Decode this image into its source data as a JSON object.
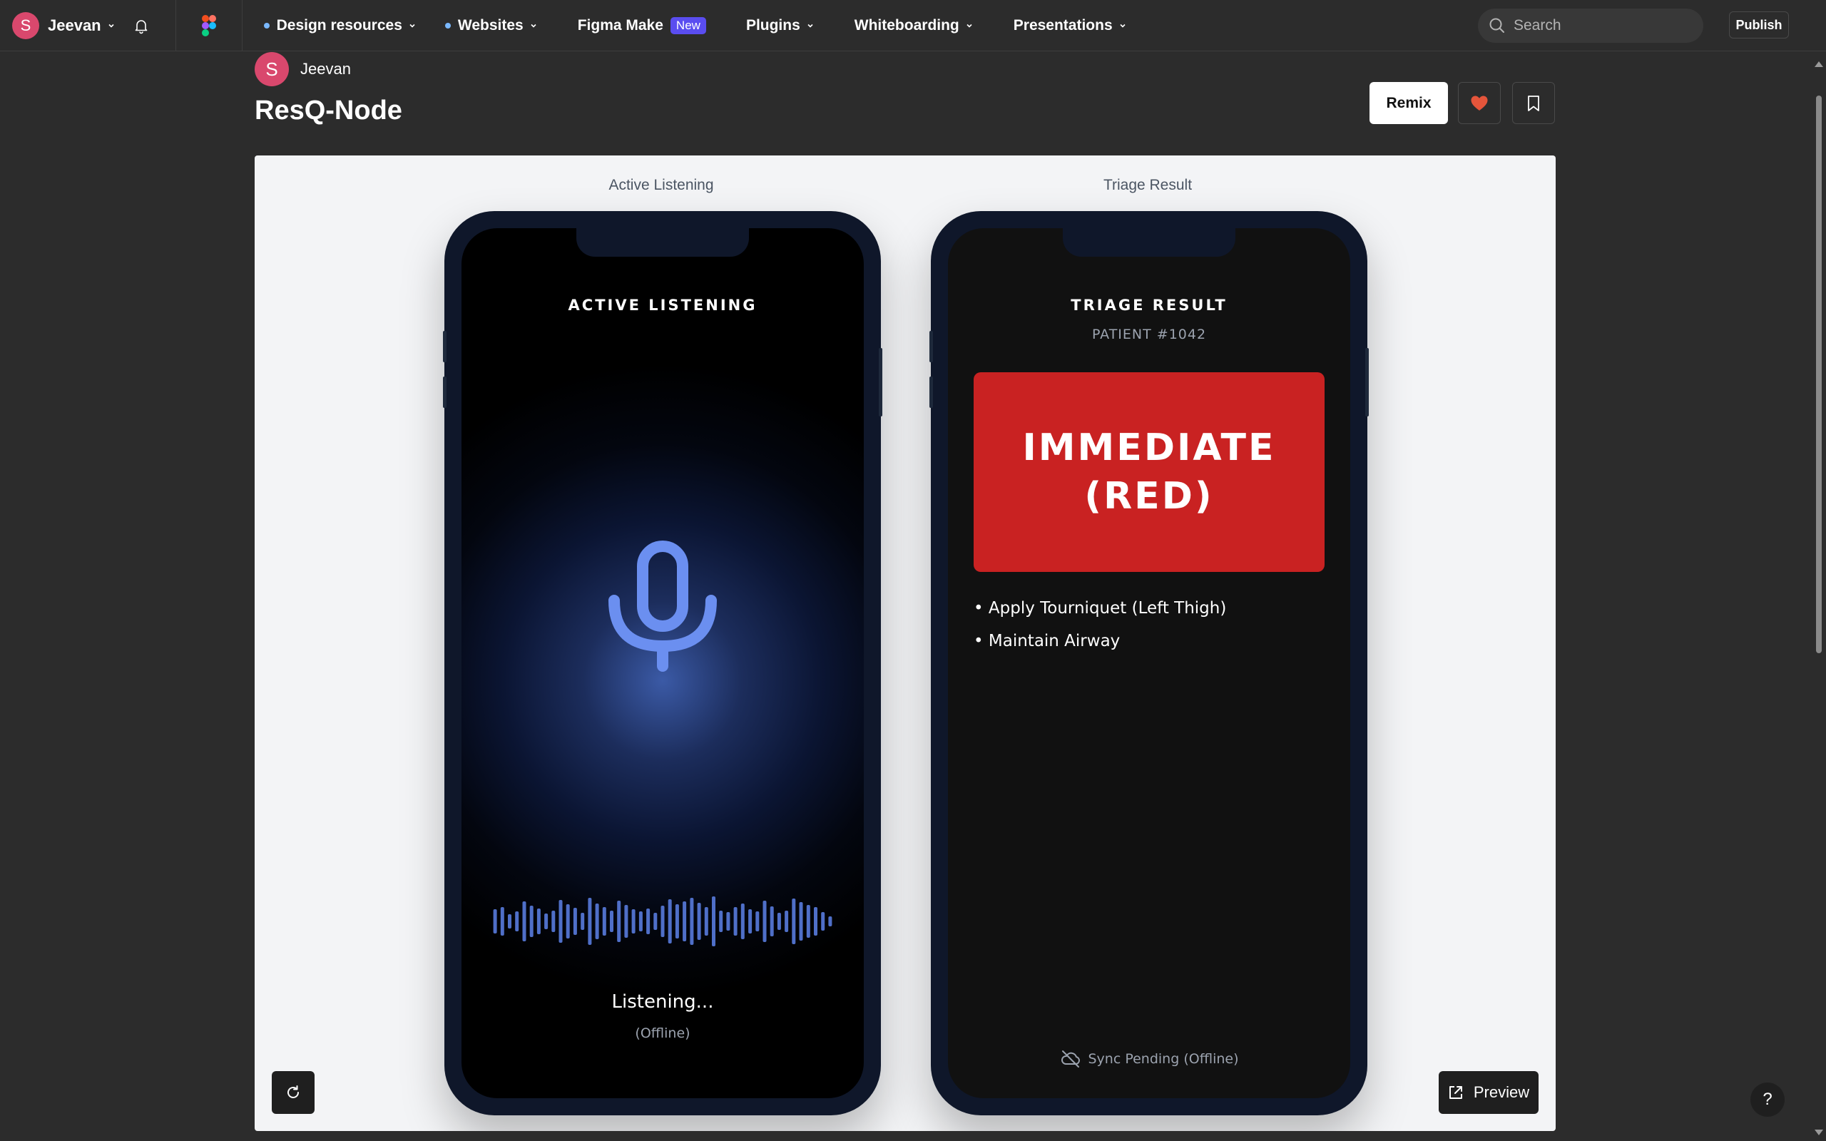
{
  "nav": {
    "user_initial": "S",
    "user_name": "Jeevan",
    "menu": [
      {
        "label": "Design resources",
        "dot": true
      },
      {
        "label": "Websites",
        "dot": true
      },
      {
        "label": "Figma Make",
        "badge": "New"
      },
      {
        "label": "Plugins"
      },
      {
        "label": "Whiteboarding"
      },
      {
        "label": "Presentations"
      }
    ],
    "search_placeholder": "Search",
    "publish_label": "Publish"
  },
  "header": {
    "author_initial": "S",
    "author_name": "Jeevan",
    "title": "ResQ-Node",
    "remix_label": "Remix"
  },
  "canvas": {
    "frame1_label": "Active Listening",
    "frame2_label": "Triage Result",
    "phone1": {
      "title": "ACTIVE LISTENING",
      "status": "Listening...",
      "substatus": "(Offline)"
    },
    "phone2": {
      "title": "TRIAGE RESULT",
      "patient": "PATIENT #1042",
      "priority": "IMMEDIATE (RED)",
      "actions": [
        "Apply Tourniquet (Left Thigh)",
        "Maintain Airway"
      ],
      "sync": "Sync Pending (Offline)"
    },
    "preview_label": "Preview"
  },
  "help_label": "?",
  "colors": {
    "accent_mic": "#6b8ff0",
    "wave": "#4f6fc8",
    "priority_red": "#c92222",
    "avatar": "#d9486d",
    "badge": "#5a4df0",
    "heart": "#e5553b"
  }
}
